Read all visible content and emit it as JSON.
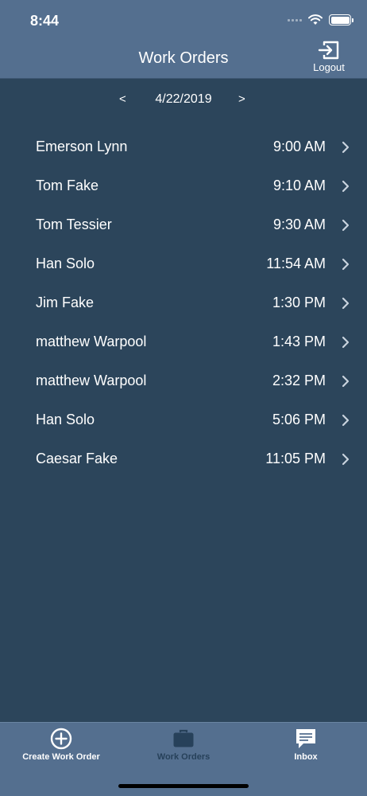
{
  "status_bar": {
    "time": "8:44"
  },
  "header": {
    "title": "Work Orders",
    "logout_label": "Logout"
  },
  "date_nav": {
    "prev": "<",
    "date": "4/22/2019",
    "next": ">"
  },
  "work_orders": [
    {
      "name": "Emerson Lynn",
      "time": "9:00 AM"
    },
    {
      "name": "Tom Fake",
      "time": "9:10 AM"
    },
    {
      "name": "Tom Tessier",
      "time": "9:30 AM"
    },
    {
      "name": "Han Solo",
      "time": "11:54 AM"
    },
    {
      "name": "Jim Fake",
      "time": "1:30 PM"
    },
    {
      "name": "matthew Warpool",
      "time": "1:43 PM"
    },
    {
      "name": "matthew Warpool",
      "time": "2:32 PM"
    },
    {
      "name": "Han Solo",
      "time": "5:06 PM"
    },
    {
      "name": "Caesar Fake",
      "time": "11:05 PM"
    }
  ],
  "tabs": [
    {
      "label": "Create Work Order",
      "icon": "plus-circle-icon",
      "active": false
    },
    {
      "label": "Work Orders",
      "icon": "briefcase-icon",
      "active": true
    },
    {
      "label": "Inbox",
      "icon": "chat-bubble-icon",
      "active": false
    }
  ],
  "colors": {
    "background": "#2c455b",
    "header": "#546f8f",
    "tabbar": "#546f8f",
    "active_tab": "#27415a",
    "text": "#ffffff"
  }
}
